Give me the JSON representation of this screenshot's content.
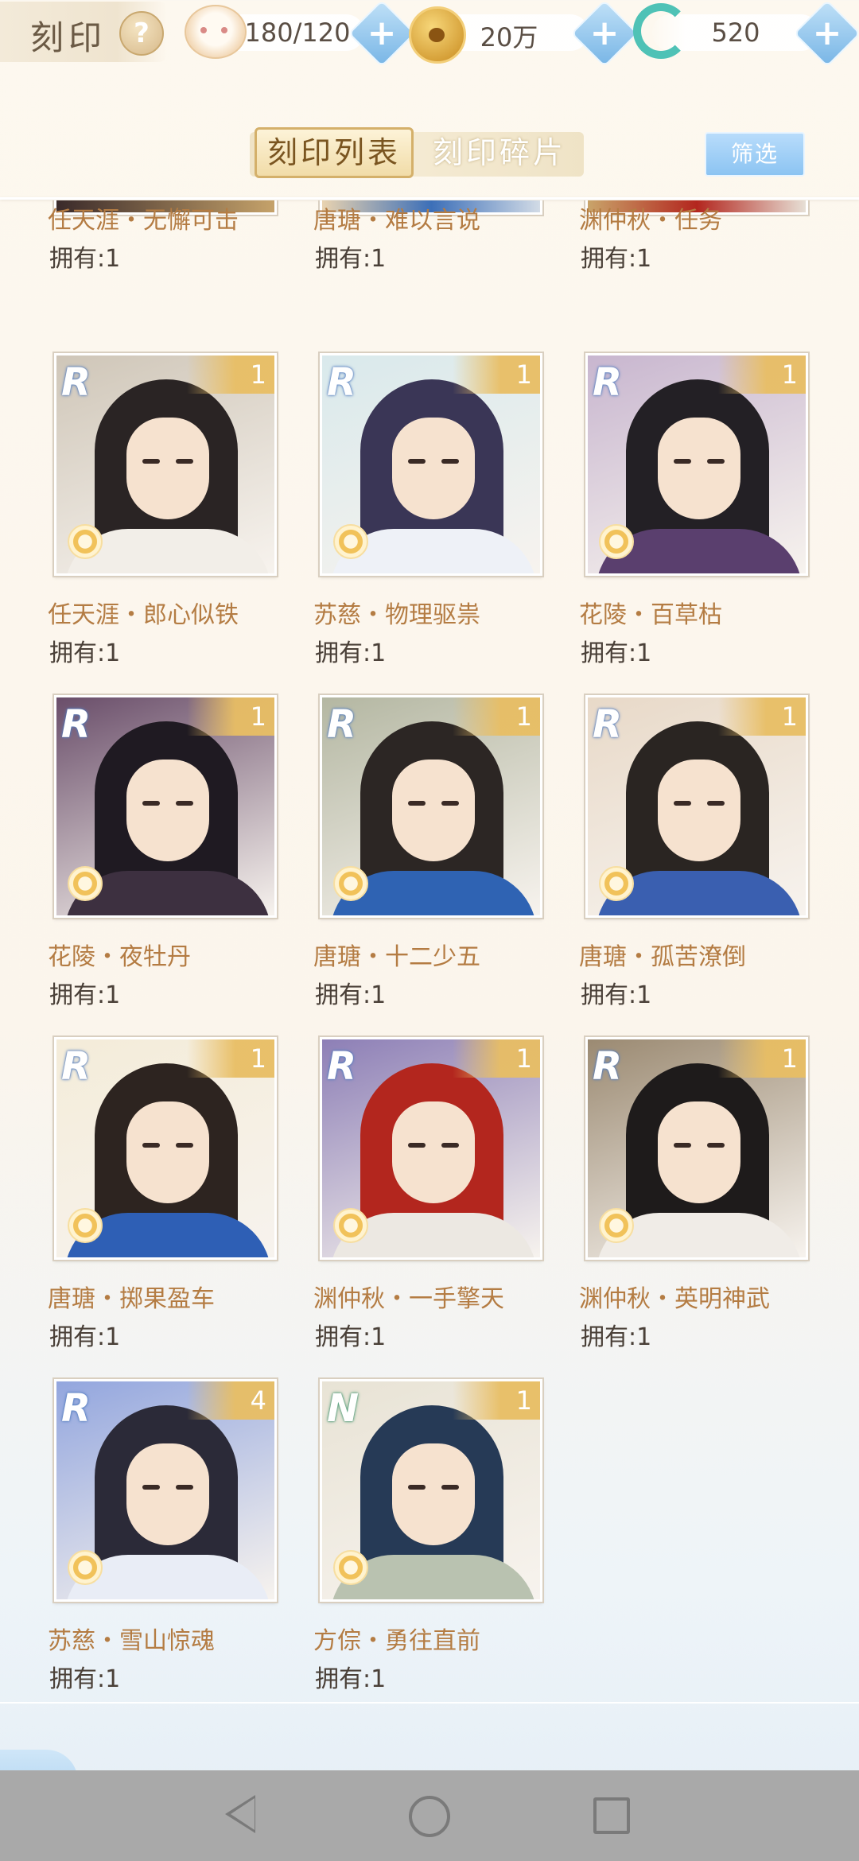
{
  "header": {
    "title": "刻印",
    "help": "?",
    "stamina": "180/120",
    "coins": "20万",
    "jade": "520"
  },
  "tabs": [
    {
      "label": "刻印列表",
      "active": true
    },
    {
      "label": "刻印碎片",
      "active": false
    }
  ],
  "filter_label": "筛选",
  "partial_row": [
    {
      "name": "任天涯・无懈可击",
      "owned": "拥有:1"
    },
    {
      "name": "唐瑭・难以言说",
      "owned": "拥有:1"
    },
    {
      "name": "渊仲秋・任务",
      "owned": "拥有:1"
    }
  ],
  "cards": [
    {
      "name": "任天涯・郎心似铁",
      "owned": "拥有:1",
      "rarity": "R",
      "count": "1",
      "hair": "#2a2424",
      "bg": "#cfc6b8",
      "cloth": "#f2eee8"
    },
    {
      "name": "苏慈・物理驱祟",
      "owned": "拥有:1",
      "rarity": "R",
      "count": "1",
      "hair": "#3a3656",
      "bg": "#d9e9ec",
      "cloth": "#eef1f7"
    },
    {
      "name": "花陵・百草枯",
      "owned": "拥有:1",
      "rarity": "R",
      "count": "1",
      "hair": "#232025",
      "bg": "#c8b6cf",
      "cloth": "#5a3f6e"
    },
    {
      "name": "花陵・夜牡丹",
      "owned": "拥有:1",
      "rarity": "R",
      "count": "1",
      "hair": "#1f1a22",
      "bg": "#6a4e6a",
      "cloth": "#3d3040"
    },
    {
      "name": "唐瑭・十二少五",
      "owned": "拥有:1",
      "rarity": "R",
      "count": "1",
      "hair": "#2c2624",
      "bg": "#b4b7a2",
      "cloth": "#2f63b3"
    },
    {
      "name": "唐瑭・孤苦潦倒",
      "owned": "拥有:1",
      "rarity": "R",
      "count": "1",
      "hair": "#2a2522",
      "bg": "#e8d9c8",
      "cloth": "#3a5fb0"
    },
    {
      "name": "唐瑭・掷果盈车",
      "owned": "拥有:1",
      "rarity": "R",
      "count": "1",
      "hair": "#2d2420",
      "bg": "#f4ecd9",
      "cloth": "#2e5fb5"
    },
    {
      "name": "渊仲秋・一手擎天",
      "owned": "拥有:1",
      "rarity": "R",
      "count": "1",
      "hair": "#b3261e",
      "bg": "#8d7fb6",
      "cloth": "#ece8e2"
    },
    {
      "name": "渊仲秋・英明神武",
      "owned": "拥有:1",
      "rarity": "R",
      "count": "1",
      "hair": "#1e1b1b",
      "bg": "#9b8a72",
      "cloth": "#f0ece7"
    },
    {
      "name": "苏慈・雪山惊魂",
      "owned": "拥有:1",
      "rarity": "R",
      "count": "4",
      "hair": "#2b2a38",
      "bg": "#93a6de",
      "cloth": "#e9edf6"
    },
    {
      "name": "方倧・勇往直前",
      "owned": "拥有:1",
      "rarity": "N",
      "count": "1",
      "hair": "#263a56",
      "bg": "#e8e3d5",
      "cloth": "#b9c2b0"
    }
  ],
  "colors": {
    "accent": "#b47c43",
    "plus": "#79b6e6",
    "tab_active": "#d4b06a"
  },
  "icons": {
    "stamina": "cat-icon",
    "coin": "paw-coin-icon",
    "jade": "jade-icon",
    "back": "back-arrow-icon"
  }
}
